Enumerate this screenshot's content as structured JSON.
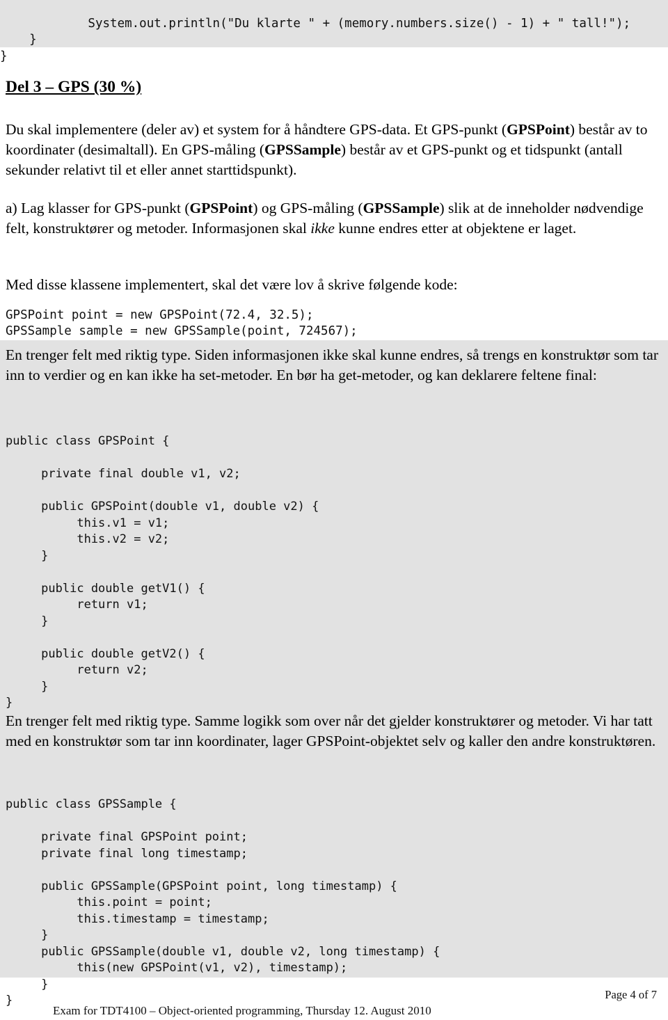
{
  "document": {
    "title": "Exam for TDT4100 – Object-oriented programming, Thursday 12. August 2010",
    "page_label": "Page 4 of 7",
    "shade_color": "#e2e2e2"
  },
  "top_code": {
    "lines": [
      "            System.out.println(\"Du klarte \" + (memory.numbers.size() - 1) + \" tall!\");",
      "    }",
      "}"
    ]
  },
  "section": {
    "heading": "Del 3 – GPS (30 %)",
    "intro_part1": "Du skal implementere (deler av) et system for å håndtere GPS-data. Et GPS-punkt (",
    "intro_bold1": "GPSPoint",
    "intro_part2": ") består av to koordinater (desimaltall). En GPS-måling (",
    "intro_bold2": "GPSSample",
    "intro_part3": ") består av et GPS-punkt og et tidspunkt (antall sekunder relativt til et eller annet starttidspunkt)."
  },
  "task_a": {
    "part1": "a) Lag klasser for GPS-punkt (",
    "bold1": "GPSPoint",
    "part2": ") og GPS-måling (",
    "bold2": "GPSSample",
    "part3": ") slik at de inneholder nødvendige felt, konstruktører og metoder. Informasjonen skal ",
    "italic1": "ikke",
    "part4": " kunne endres etter at objektene er laget."
  },
  "example": {
    "lead": "Med disse klassene implementert, skal det være lov å skrive følgende kode:",
    "lines": [
      "GPSPoint point = new GPSPoint(72.4, 32.5);",
      "GPSSample sample = new GPSSample(point, 724567);"
    ]
  },
  "answer_gpspoint": {
    "explanation": "En trenger felt med riktig type. Siden informasjonen ikke skal kunne endres, så trengs en konstruktør som tar inn to verdier og en kan ikke ha set-metoder. En bør ha get-metoder, og kan deklarere feltene final:",
    "code_lines": [
      "public class GPSPoint {",
      "",
      "     private final double v1, v2;",
      "",
      "     public GPSPoint(double v1, double v2) {",
      "          this.v1 = v1;",
      "          this.v2 = v2;",
      "     }",
      "",
      "     public double getV1() {",
      "          return v1;",
      "     }",
      "",
      "     public double getV2() {",
      "          return v2;",
      "     }",
      "}"
    ]
  },
  "answer_gpssample": {
    "explanation": "En trenger felt med riktig type. Samme logikk som over når det gjelder konstruktører og metoder. Vi har tatt med en konstruktør som tar inn koordinater, lager GPSPoint-objektet selv og kaller den andre konstruktøren.",
    "code_lines": [
      "public class GPSSample {",
      "",
      "     private final GPSPoint point;",
      "     private final long timestamp;",
      "",
      "     public GPSSample(GPSPoint point, long timestamp) {",
      "          this.point = point;",
      "          this.timestamp = timestamp;",
      "     }",
      "     public GPSSample(double v1, double v2, long timestamp) {",
      "          this(new GPSPoint(v1, v2), timestamp);",
      "     }",
      "}"
    ]
  }
}
